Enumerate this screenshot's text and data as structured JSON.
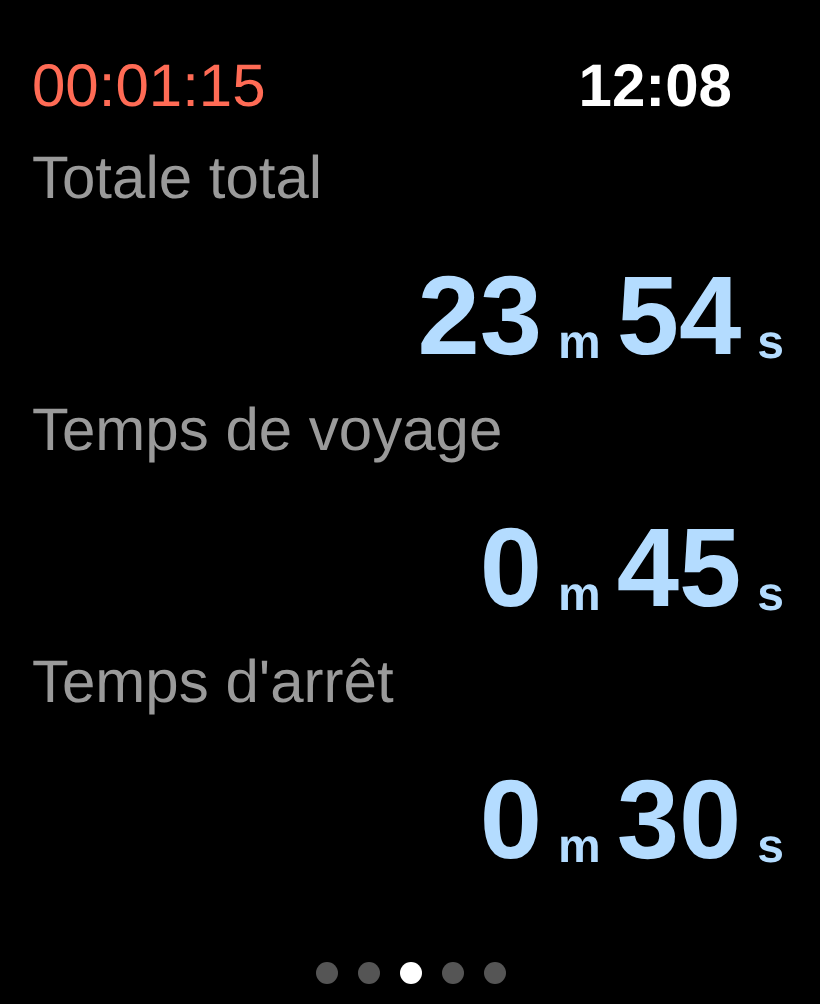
{
  "status_bar": {
    "timer": "00:01:15",
    "clock": "12:08"
  },
  "metrics": [
    {
      "label": "Totale total",
      "values": [
        {
          "number": "23",
          "unit": "m"
        },
        {
          "number": "54",
          "unit": "s"
        }
      ]
    },
    {
      "label": "Temps de voyage",
      "values": [
        {
          "number": "0",
          "unit": "m"
        },
        {
          "number": "45",
          "unit": "s"
        }
      ]
    },
    {
      "label": "Temps d'arrêt",
      "values": [
        {
          "number": "0",
          "unit": "m"
        },
        {
          "number": "30",
          "unit": "s"
        }
      ]
    }
  ],
  "pages": [
    {
      "selected": false
    },
    {
      "selected": false
    },
    {
      "selected": true
    },
    {
      "selected": false
    },
    {
      "selected": false
    }
  ]
}
